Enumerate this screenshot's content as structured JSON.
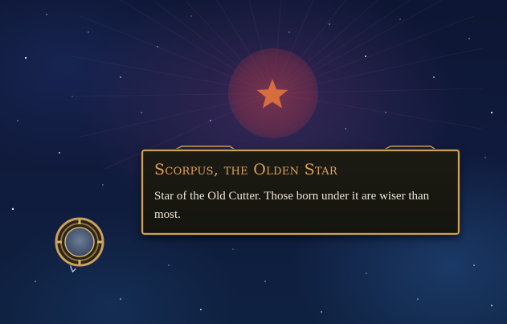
{
  "tooltip": {
    "title": "Scorpus, the Olden Star",
    "description": "Star of the Old Cutter. Those born under it are wiser than most."
  },
  "constellation": {
    "icon": "star-icon",
    "highlight_color": "#a83c46",
    "star_color": "#e0723c"
  },
  "medallion": {
    "icon": "compass-medallion-icon",
    "rim_color": "#c9a15c"
  },
  "colors": {
    "title": "#e2a25a",
    "body_text": "#ece4d2",
    "panel_border": "#c9a15c",
    "panel_bg": "#1b1a13"
  }
}
